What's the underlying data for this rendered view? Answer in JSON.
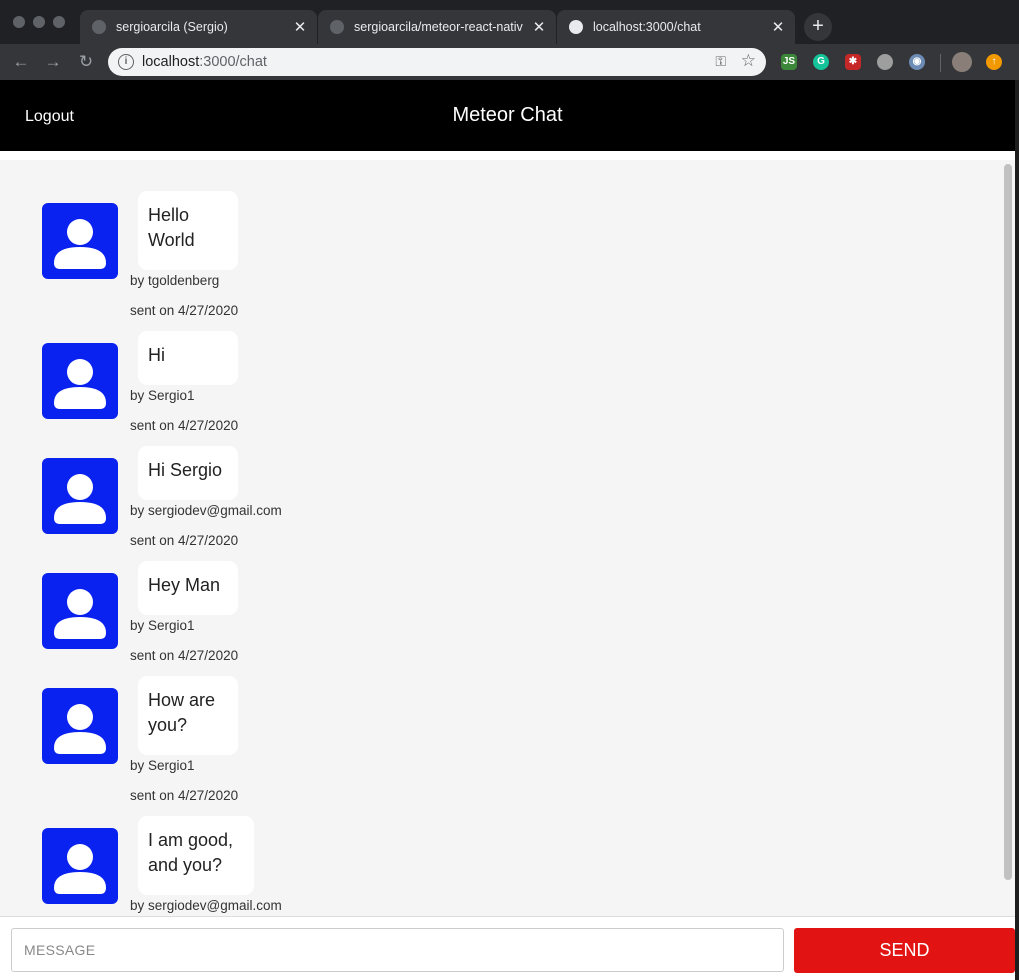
{
  "browser": {
    "tabs": [
      {
        "title": "sergioarcila (Sergio)",
        "close": "✕"
      },
      {
        "title": "sergioarcila/meteor-react-nativ",
        "close": "✕"
      },
      {
        "title": "localhost:3000/chat",
        "close": "✕"
      }
    ],
    "new_tab": "+",
    "url_host": "localhost",
    "url_path": ":3000/chat",
    "nav": {
      "back": "←",
      "forward": "→",
      "reload": "↻"
    },
    "extensions": [
      "node-icon",
      "grammarly-icon",
      "extension-red-icon",
      "extension-gray-icon",
      "extension-eyes-icon",
      "profile-avatar",
      "update-icon"
    ]
  },
  "app": {
    "logout_label": "Logout",
    "title": "Meteor Chat"
  },
  "messages": [
    {
      "text": "Hello\nWorld",
      "by": "by tgoldenberg",
      "sent": "sent on 4/27/2020"
    },
    {
      "text": "Hi",
      "by": "by Sergio1",
      "sent": "sent on 4/27/2020"
    },
    {
      "text": "Hi Sergio",
      "by": "by sergiodev@gmail.com",
      "sent": "sent on 4/27/2020"
    },
    {
      "text": "Hey Man",
      "by": "by Sergio1",
      "sent": "sent on 4/27/2020"
    },
    {
      "text": "How are\nyou?",
      "by": "by Sergio1",
      "sent": "sent on 4/27/2020"
    },
    {
      "text": "I am good,\nand you?",
      "by": "by sergiodev@gmail.com",
      "sent": ""
    }
  ],
  "composer": {
    "placeholder": "MESSAGE",
    "send_label": "SEND"
  },
  "colors": {
    "header_bg": "#000000",
    "avatar_bg": "#0a22f0",
    "send_button": "#e21313",
    "chat_bg": "#f5f5f5"
  }
}
